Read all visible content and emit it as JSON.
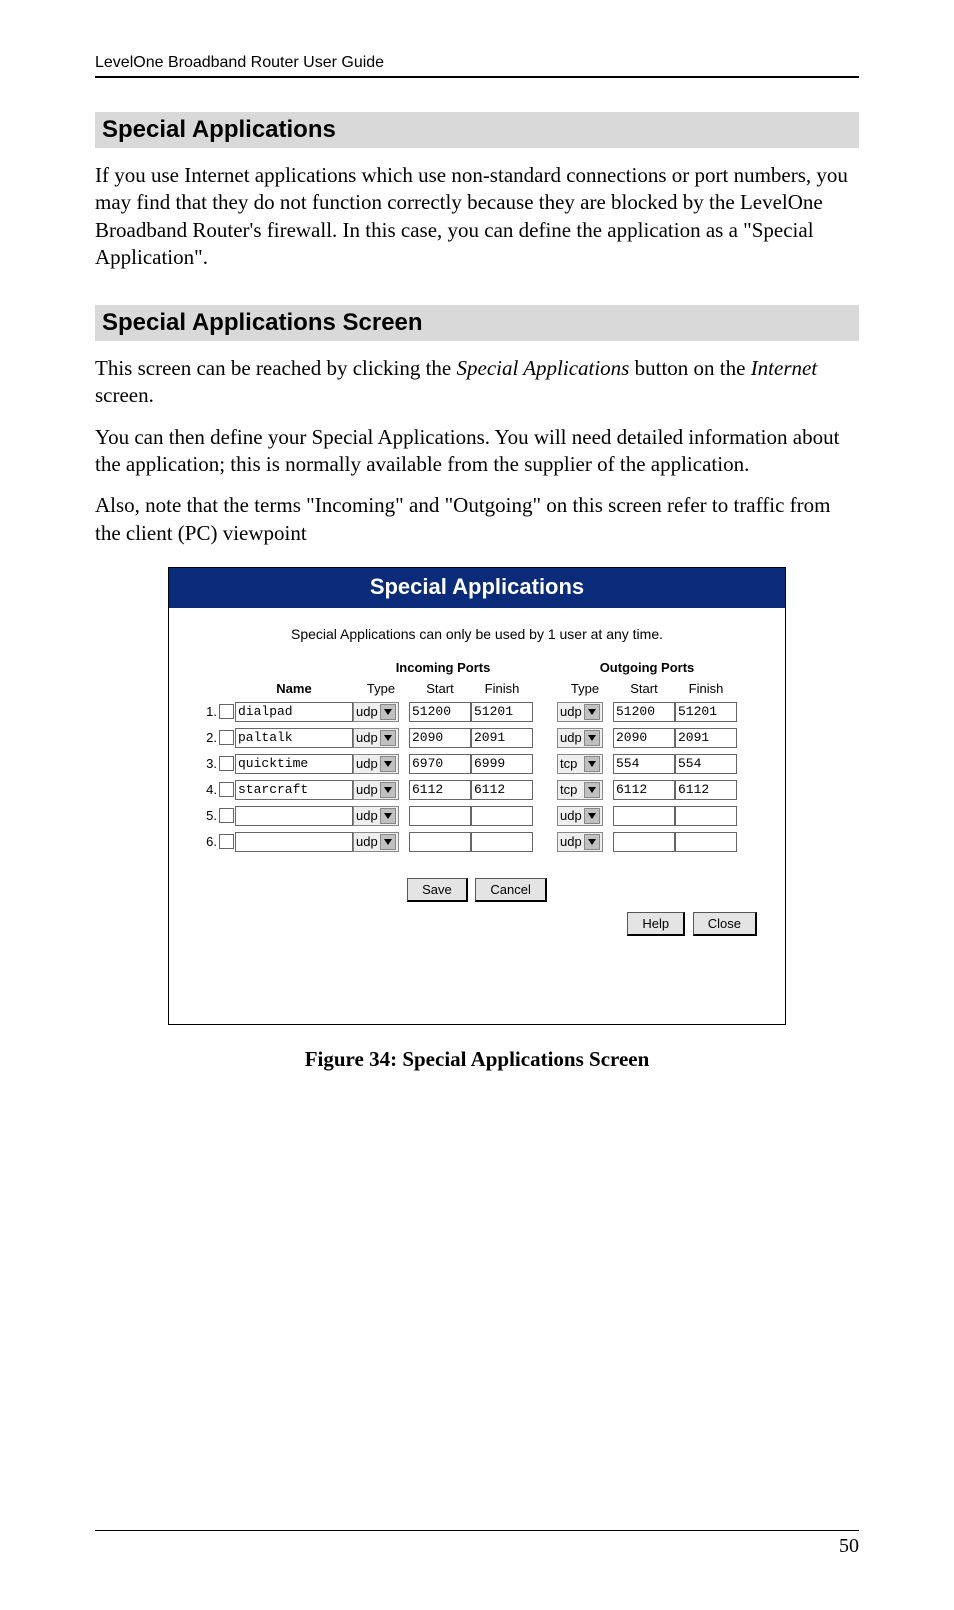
{
  "header": {
    "title": "LevelOne Broadband Router User Guide"
  },
  "section1_title": "Special Applications",
  "section1_para": "If you use Internet applications which use non-standard connections or port numbers, you may find that they do not function correctly because they are blocked by the LevelOne Broadband Router's firewall. In this case, you can define the application as a \"Special Application\".",
  "section2_title": "Special Applications Screen",
  "p_reach_a": "This screen can be reached by clicking the ",
  "p_reach_it1": "Special Applications",
  "p_reach_b": " button on the ",
  "p_reach_it2": "Internet",
  "p_reach_c": " screen.",
  "p_define": "You can then define your Special Applications. You will need detailed information about the application; this is normally available from the supplier of the application.",
  "p_also": "Also, note that the terms \"Incoming\" and \"Outgoing\" on this screen refer to traffic from the client (PC) viewpoint",
  "shot": {
    "title": "Special Applications",
    "note": "Special Applications can only be used by 1 user at any time.",
    "col_name": "Name",
    "col_in": "Incoming Ports",
    "col_out": "Outgoing Ports",
    "sub_type": "Type",
    "sub_start": "Start",
    "sub_finish": "Finish",
    "rows": [
      {
        "num": "1.",
        "name": "dialpad",
        "in_type": "udp",
        "in_start": "51200",
        "in_finish": "51201",
        "out_type": "udp",
        "out_start": "51200",
        "out_finish": "51201"
      },
      {
        "num": "2.",
        "name": "paltalk",
        "in_type": "udp",
        "in_start": "2090",
        "in_finish": "2091",
        "out_type": "udp",
        "out_start": "2090",
        "out_finish": "2091"
      },
      {
        "num": "3.",
        "name": "quicktime",
        "in_type": "udp",
        "in_start": "6970",
        "in_finish": "6999",
        "out_type": "tcp",
        "out_start": "554",
        "out_finish": "554"
      },
      {
        "num": "4.",
        "name": "starcraft",
        "in_type": "udp",
        "in_start": "6112",
        "in_finish": "6112",
        "out_type": "tcp",
        "out_start": "6112",
        "out_finish": "6112"
      },
      {
        "num": "5.",
        "name": "",
        "in_type": "udp",
        "in_start": "",
        "in_finish": "",
        "out_type": "udp",
        "out_start": "",
        "out_finish": ""
      },
      {
        "num": "6.",
        "name": "",
        "in_type": "udp",
        "in_start": "",
        "in_finish": "",
        "out_type": "udp",
        "out_start": "",
        "out_finish": ""
      }
    ],
    "btn_save": "Save",
    "btn_cancel": "Cancel",
    "btn_help": "Help",
    "btn_close": "Close"
  },
  "caption": "Figure 34: Special Applications Screen",
  "page_number": "50"
}
